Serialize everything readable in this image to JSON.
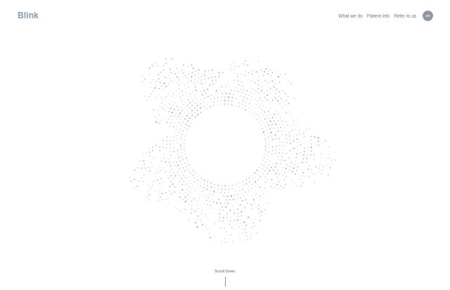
{
  "logo": "Blink",
  "nav": [
    {
      "label": "What we do"
    },
    {
      "label": "Patient info"
    },
    {
      "label": "Refer to us"
    }
  ],
  "account": {
    "label": "om"
  },
  "scroll_hint": "Scroll Down"
}
